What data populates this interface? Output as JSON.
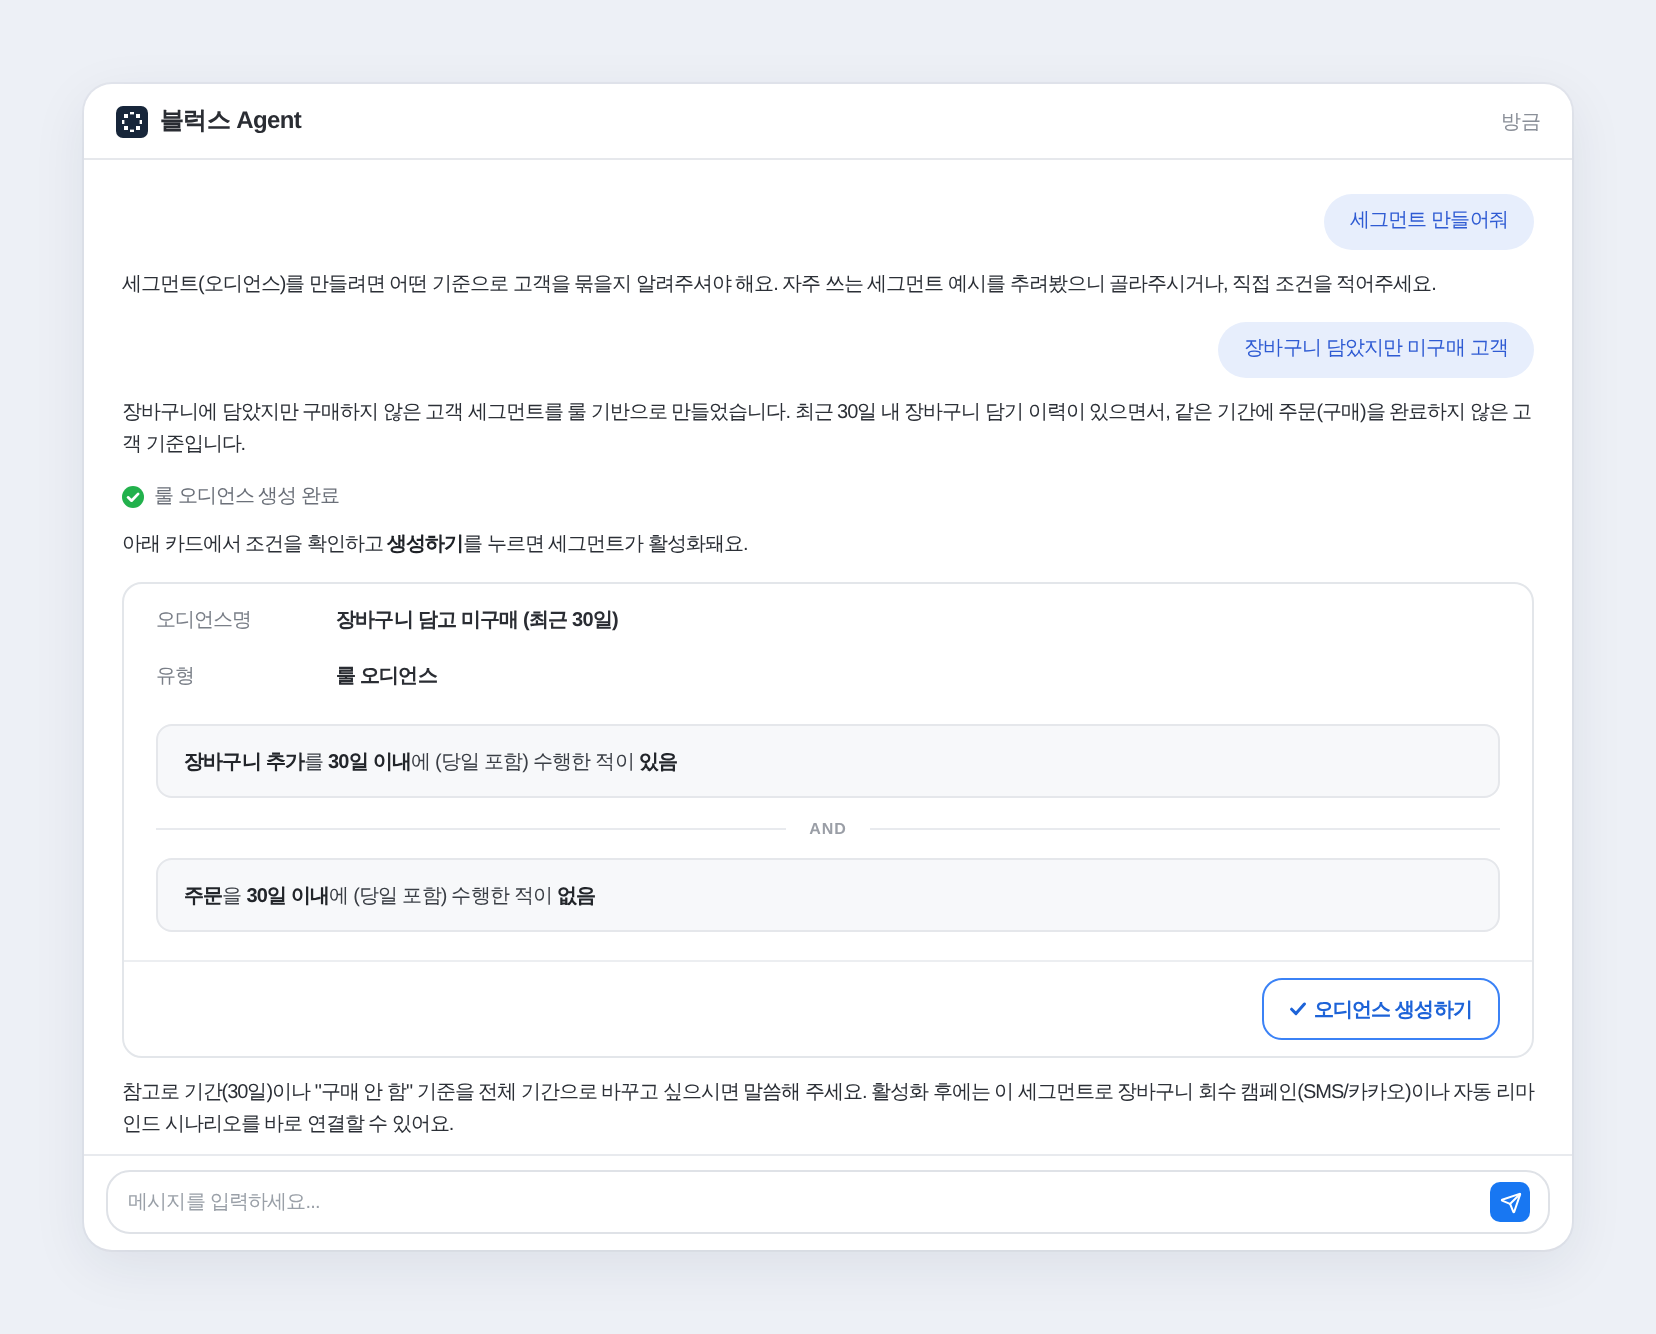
{
  "header": {
    "title": "블럭스 Agent",
    "timestamp": "방금"
  },
  "messages": [
    {
      "kind": "user",
      "text": "세그먼트 만들어줘"
    },
    {
      "kind": "assistant",
      "text": "세그먼트(오디언스)를 만들려면 어떤 기준으로 고객을 묶을지 알려주셔야 해요. 자주 쓰는 세그먼트 예시를 추려봤으니 골라주시거나, 직접 조건을 적어주세요."
    },
    {
      "kind": "user",
      "text": "장바구니 담았지만 미구매 고객"
    },
    {
      "kind": "assistant",
      "text": "장바구니에 담았지만 구매하지 않은 고객 세그먼트를 룰 기반으로 만들었습니다. 최근 30일 내 장바구니 담기 이력이 있으면서, 같은 기간에 주문(구매)을 완료하지 않은 고객 기준입니다."
    },
    {
      "kind": "status",
      "text": "룰 오디언스 생성 완료"
    },
    {
      "kind": "assistant",
      "text": "아래 카드에서 조건을 확인하고 **생성하기**를 누르면 세그먼트가 활성화돼요."
    },
    {
      "kind": "audience_card",
      "fields": [
        {
          "label": "오디언스명",
          "value": "장바구니 담고 미구매 (최근 30일)"
        },
        {
          "label": "유형",
          "value": "룰 오디언스"
        }
      ],
      "conditions": [
        "**장바구니 추가**를 **30일 이내**에 (당일 포함) 수행한 적이 **있음**",
        "**주문**을 **30일 이내**에 (당일 포함) 수행한 적이 **없음**"
      ],
      "operator": "AND",
      "button": "오디언스 생성하기"
    },
    {
      "kind": "assistant",
      "text": "참고로 기간(30일)이나 \"구매 안 함\" 기준을 전체 기간으로 바꾸고 싶으시면 말씀해 주세요. 활성화 후에는 이 세그먼트로 장바구니 회수 캠페인(SMS/카카오)이나 자동 리마인드 시나리오를 바로 연결할 수 있어요."
    }
  ],
  "composer": {
    "placeholder": "메시지를 입력하세요..."
  }
}
